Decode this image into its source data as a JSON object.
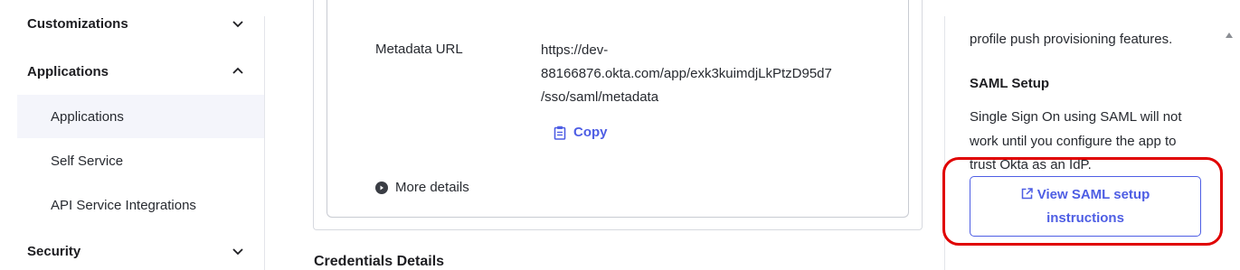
{
  "sidebar": {
    "groups": [
      {
        "label": "Customizations",
        "expanded": false
      },
      {
        "label": "Applications",
        "expanded": true
      },
      {
        "label": "Security",
        "expanded": false
      }
    ],
    "sub_items": [
      {
        "label": "Applications",
        "active": true
      },
      {
        "label": "Self Service",
        "active": false
      },
      {
        "label": "API Service Integrations",
        "active": false
      }
    ]
  },
  "main": {
    "metadata_label": "Metadata URL",
    "metadata_url_lines": [
      "https://dev-",
      "88166876.okta.com/app/exk3kuimdjLkPtzD95d7",
      "/sso/saml/metadata"
    ],
    "copy_label": "Copy",
    "more_details_label": "More details",
    "credentials_title": "Credentials Details"
  },
  "right": {
    "intro_tail": "profile push provisioning features.",
    "saml_title": "SAML Setup",
    "saml_desc_lines": [
      "Single Sign On using SAML will not",
      "work until you configure the app to",
      "trust Okta as an IdP."
    ],
    "saml_button_lines": [
      "View SAML setup",
      "instructions"
    ]
  },
  "colors": {
    "accent": "#4e5ee4",
    "highlight": "#e00000",
    "active_bg": "#f4f5fb"
  },
  "icons": [
    "chevron-down-icon",
    "chevron-up-icon",
    "clipboard-icon",
    "play-circle-icon",
    "external-link-icon"
  ]
}
